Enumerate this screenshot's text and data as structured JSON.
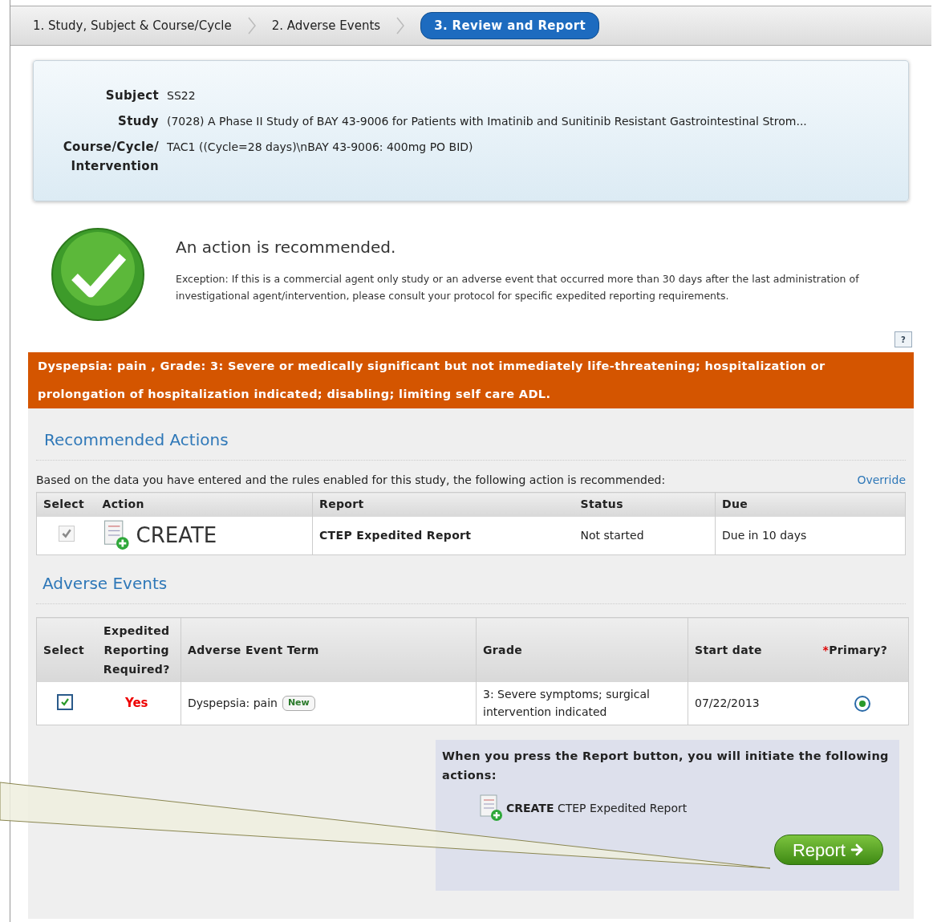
{
  "steps": [
    {
      "label": "1. Study, Subject & Course/Cycle",
      "selected": false
    },
    {
      "label": "2. Adverse Events",
      "selected": false
    },
    {
      "label": "3. Review and Report",
      "selected": true
    }
  ],
  "subject_info": [
    {
      "label": "Subject",
      "value": "SS22"
    },
    {
      "label": "Study",
      "value": "(7028) A Phase II Study of BAY 43-9006 for Patients with Imatinib and Sunitinib Resistant Gastrointestinal Strom..."
    },
    {
      "label": "Course/Cycle/ Intervention",
      "value": "TAC1 ((Cycle=28 days)\\nBAY 43-9006: 400mg PO BID)"
    }
  ],
  "recommendation": {
    "title": "An action is recommended.",
    "exception": "Exception: If this is a commercial agent only study or an adverse event that occurred more than 30 days after the last administration of investigational agent/intervention, please consult your protocol for specific expedited reporting requirements.",
    "help": "?"
  },
  "alert": "Dyspepsia: pain , Grade: 3: Severe or medically significant but not immediately life-threatening; hospitalization or prolongation of hospitalization indicated; disabling; limiting self care ADL.",
  "recommended_actions": {
    "title": "Recommended Actions",
    "intro": "Based on the data you have entered and the rules enabled for this study, the following action is recommended:",
    "override": "Override",
    "columns": [
      "Select",
      "Action",
      "Report",
      "Status",
      "Due"
    ],
    "rows": [
      {
        "checked": true,
        "disabled": true,
        "action": "CREATE",
        "report": "CTEP Expedited Report",
        "status": "Not started",
        "due": "Due in 10 days"
      }
    ]
  },
  "adverse_events": {
    "title": "Adverse Events",
    "columns": [
      "Select",
      "Expedited Reporting Required?",
      "Adverse Event Term",
      "Grade",
      "Start date",
      "Primary?"
    ],
    "required_mark": "*",
    "rows": [
      {
        "checked": true,
        "expedited": "Yes",
        "term": "Dyspepsia: pain",
        "badge": "New",
        "grade": "3: Severe symptoms; surgical intervention indicated",
        "start_date": "07/22/2013",
        "primary": true
      }
    ]
  },
  "report_panel": {
    "message": "When you press the Report button, you will initiate the following actions:",
    "actions": [
      {
        "verb": "CREATE",
        "report": "CTEP Expedited Report"
      }
    ],
    "button": "Report"
  }
}
